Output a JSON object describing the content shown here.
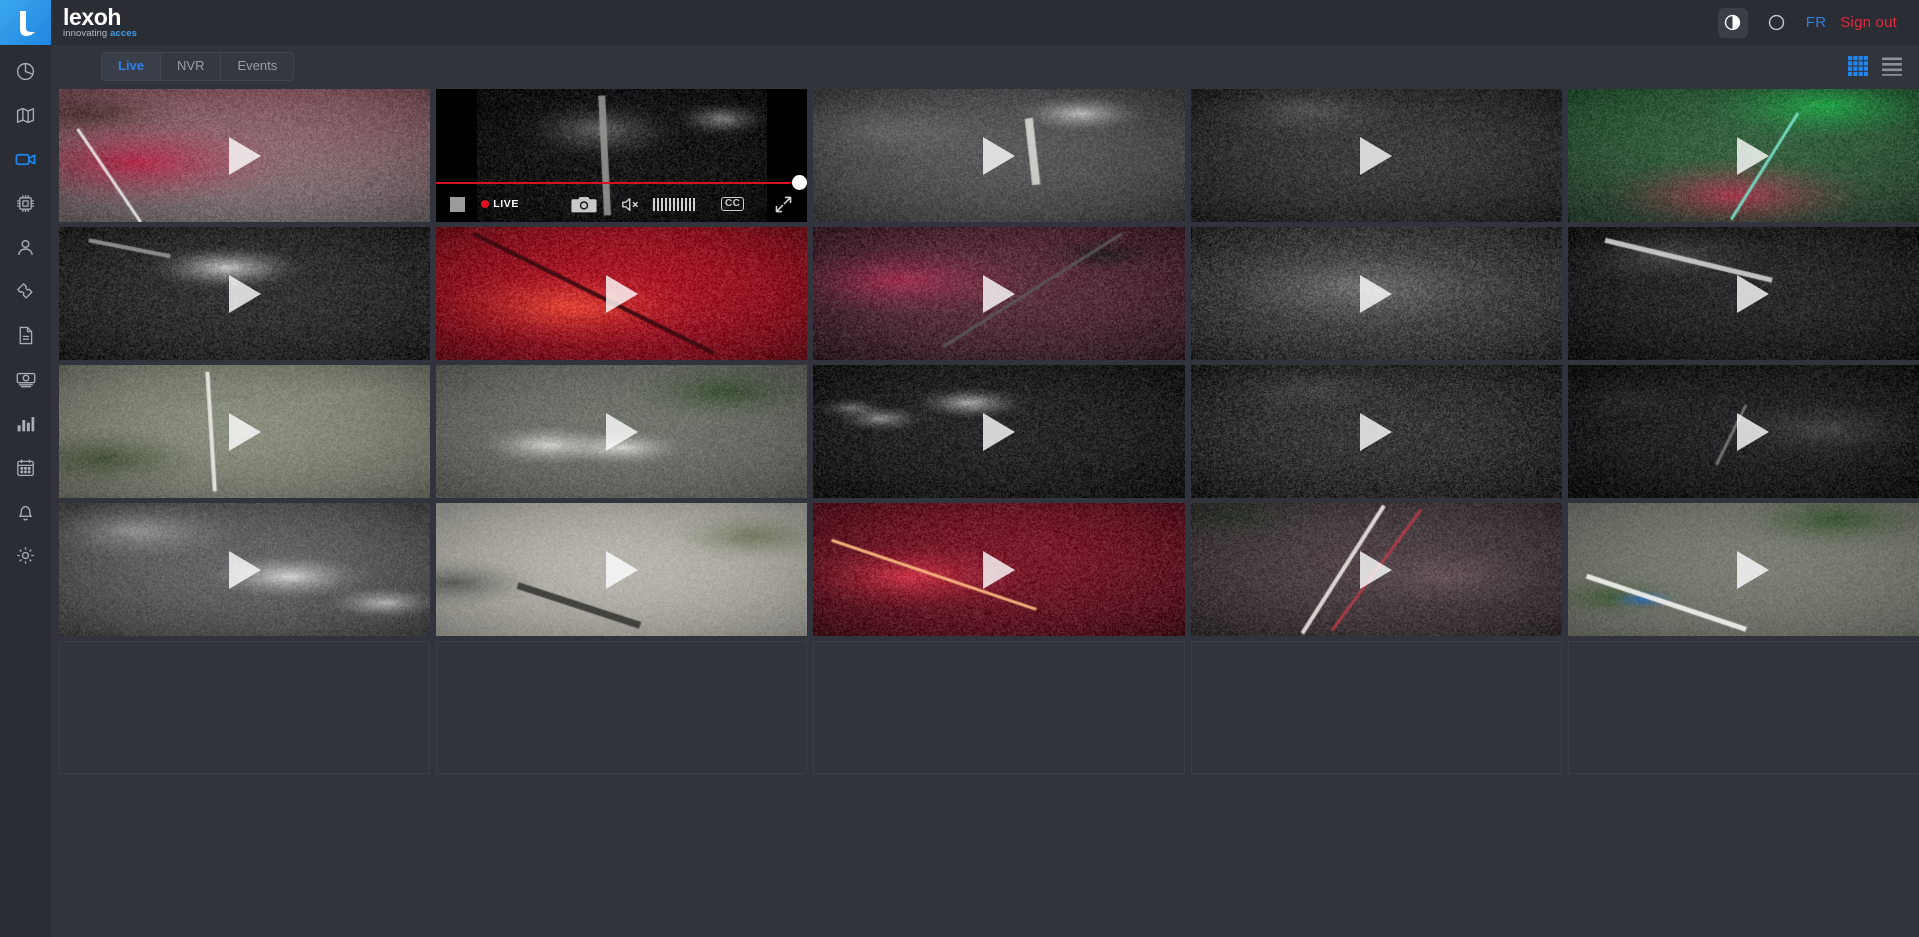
{
  "header": {
    "logo": {
      "word": "lexoh",
      "tagline_plain": "innovating ",
      "tagline_accent": "acces",
      "icon": "lexoh-logo-mark"
    },
    "theme_toggle_icon": "contrast-half-circle-icon",
    "theme_circle_icon": "empty-circle-icon",
    "language": "FR",
    "sign_out": "Sign out",
    "colors": {
      "lang": "#2f7fe0",
      "signout": "#e0293f",
      "brand": "#1f86de"
    }
  },
  "sidebar": {
    "items": [
      {
        "icon": "pie-chart-icon",
        "name": "dashboard",
        "active": false
      },
      {
        "icon": "map-icon",
        "name": "map",
        "active": false
      },
      {
        "icon": "video-camera-icon",
        "name": "cameras",
        "active": true
      },
      {
        "icon": "chip-icon",
        "name": "devices",
        "active": false
      },
      {
        "icon": "user-icon",
        "name": "users",
        "active": false
      },
      {
        "icon": "ticket-icon",
        "name": "tickets",
        "active": false
      },
      {
        "icon": "document-icon",
        "name": "documents",
        "active": false
      },
      {
        "icon": "cash-icon",
        "name": "billing",
        "active": false
      },
      {
        "icon": "bar-chart-icon",
        "name": "reports",
        "active": false
      },
      {
        "icon": "calendar-icon",
        "name": "calendar",
        "active": false
      },
      {
        "icon": "bell-icon",
        "name": "notifications",
        "active": false
      },
      {
        "icon": "gear-icon",
        "name": "settings",
        "active": false
      }
    ]
  },
  "toolbar": {
    "tabs": [
      {
        "label": "Live",
        "active": true
      },
      {
        "label": "NVR",
        "active": false
      },
      {
        "label": "Events",
        "active": false
      }
    ],
    "grid_view_icon": "grid-view-icon",
    "list_view_icon": "list-view-icon",
    "grid_view_active": true,
    "accent": "#1f86f0"
  },
  "player": {
    "stop_icon": "stop-square-icon",
    "live_label": "LIVE",
    "snapshot_icon": "camera-snapshot-icon",
    "mute_icon": "speaker-muted-icon",
    "volume_icon": "volume-bars-icon",
    "volume_bar_count": 11,
    "cc_label": "CC",
    "cc_icon": "closed-caption-icon",
    "fullscreen_icon": "expand-arrows-icon",
    "seek_progress_percent": 100,
    "seek_color": "#d81020"
  },
  "grid": {
    "columns": 5,
    "cells": [
      {
        "index": 0,
        "kind": "thumbnail",
        "state": "paused",
        "scene": "daylight-asphalt-red-barrier"
      },
      {
        "index": 1,
        "kind": "player",
        "state": "live",
        "scene": "night-pole-parking"
      },
      {
        "index": 2,
        "kind": "thumbnail",
        "state": "paused",
        "scene": "night-foggy-sign-gray"
      },
      {
        "index": 3,
        "kind": "thumbnail",
        "state": "paused",
        "scene": "night-dark-asphalt-gray"
      },
      {
        "index": 4,
        "kind": "thumbnail",
        "state": "paused",
        "scene": "night-green-ir-red-path"
      },
      {
        "index": 5,
        "kind": "thumbnail",
        "state": "paused",
        "scene": "night-white-panel-gravel"
      },
      {
        "index": 6,
        "kind": "thumbnail",
        "state": "paused",
        "scene": "night-red-ir-road"
      },
      {
        "index": 7,
        "kind": "thumbnail",
        "state": "paused",
        "scene": "night-pink-gravel-pole"
      },
      {
        "index": 8,
        "kind": "thumbnail",
        "state": "paused",
        "scene": "night-gravel-gray-dome"
      },
      {
        "index": 9,
        "kind": "thumbnail",
        "state": "paused",
        "scene": "night-dark-streak-gray"
      },
      {
        "index": 10,
        "kind": "thumbnail",
        "state": "paused",
        "scene": "day-concrete-pole-green"
      },
      {
        "index": 11,
        "kind": "thumbnail",
        "state": "paused",
        "scene": "day-white-blocks-gravel"
      },
      {
        "index": 12,
        "kind": "thumbnail",
        "state": "paused",
        "scene": "night-white-blocks-dark"
      },
      {
        "index": 13,
        "kind": "thumbnail",
        "state": "paused",
        "scene": "night-gravel-dark-gray"
      },
      {
        "index": 14,
        "kind": "thumbnail",
        "state": "paused",
        "scene": "night-dark-tunnel-gray"
      },
      {
        "index": 15,
        "kind": "thumbnail",
        "state": "paused",
        "scene": "night-blurred-lights-bw"
      },
      {
        "index": 16,
        "kind": "thumbnail",
        "state": "paused",
        "scene": "day-concrete-grate"
      },
      {
        "index": 17,
        "kind": "thumbnail",
        "state": "paused",
        "scene": "night-red-ir-stripe-road"
      },
      {
        "index": 18,
        "kind": "thumbnail",
        "state": "paused",
        "scene": "night-road-white-line"
      },
      {
        "index": 19,
        "kind": "thumbnail",
        "state": "paused",
        "scene": "day-boom-barrier-green"
      },
      {
        "index": 20,
        "kind": "empty"
      },
      {
        "index": 21,
        "kind": "empty"
      },
      {
        "index": 22,
        "kind": "empty"
      },
      {
        "index": 23,
        "kind": "empty"
      },
      {
        "index": 24,
        "kind": "empty"
      }
    ]
  }
}
